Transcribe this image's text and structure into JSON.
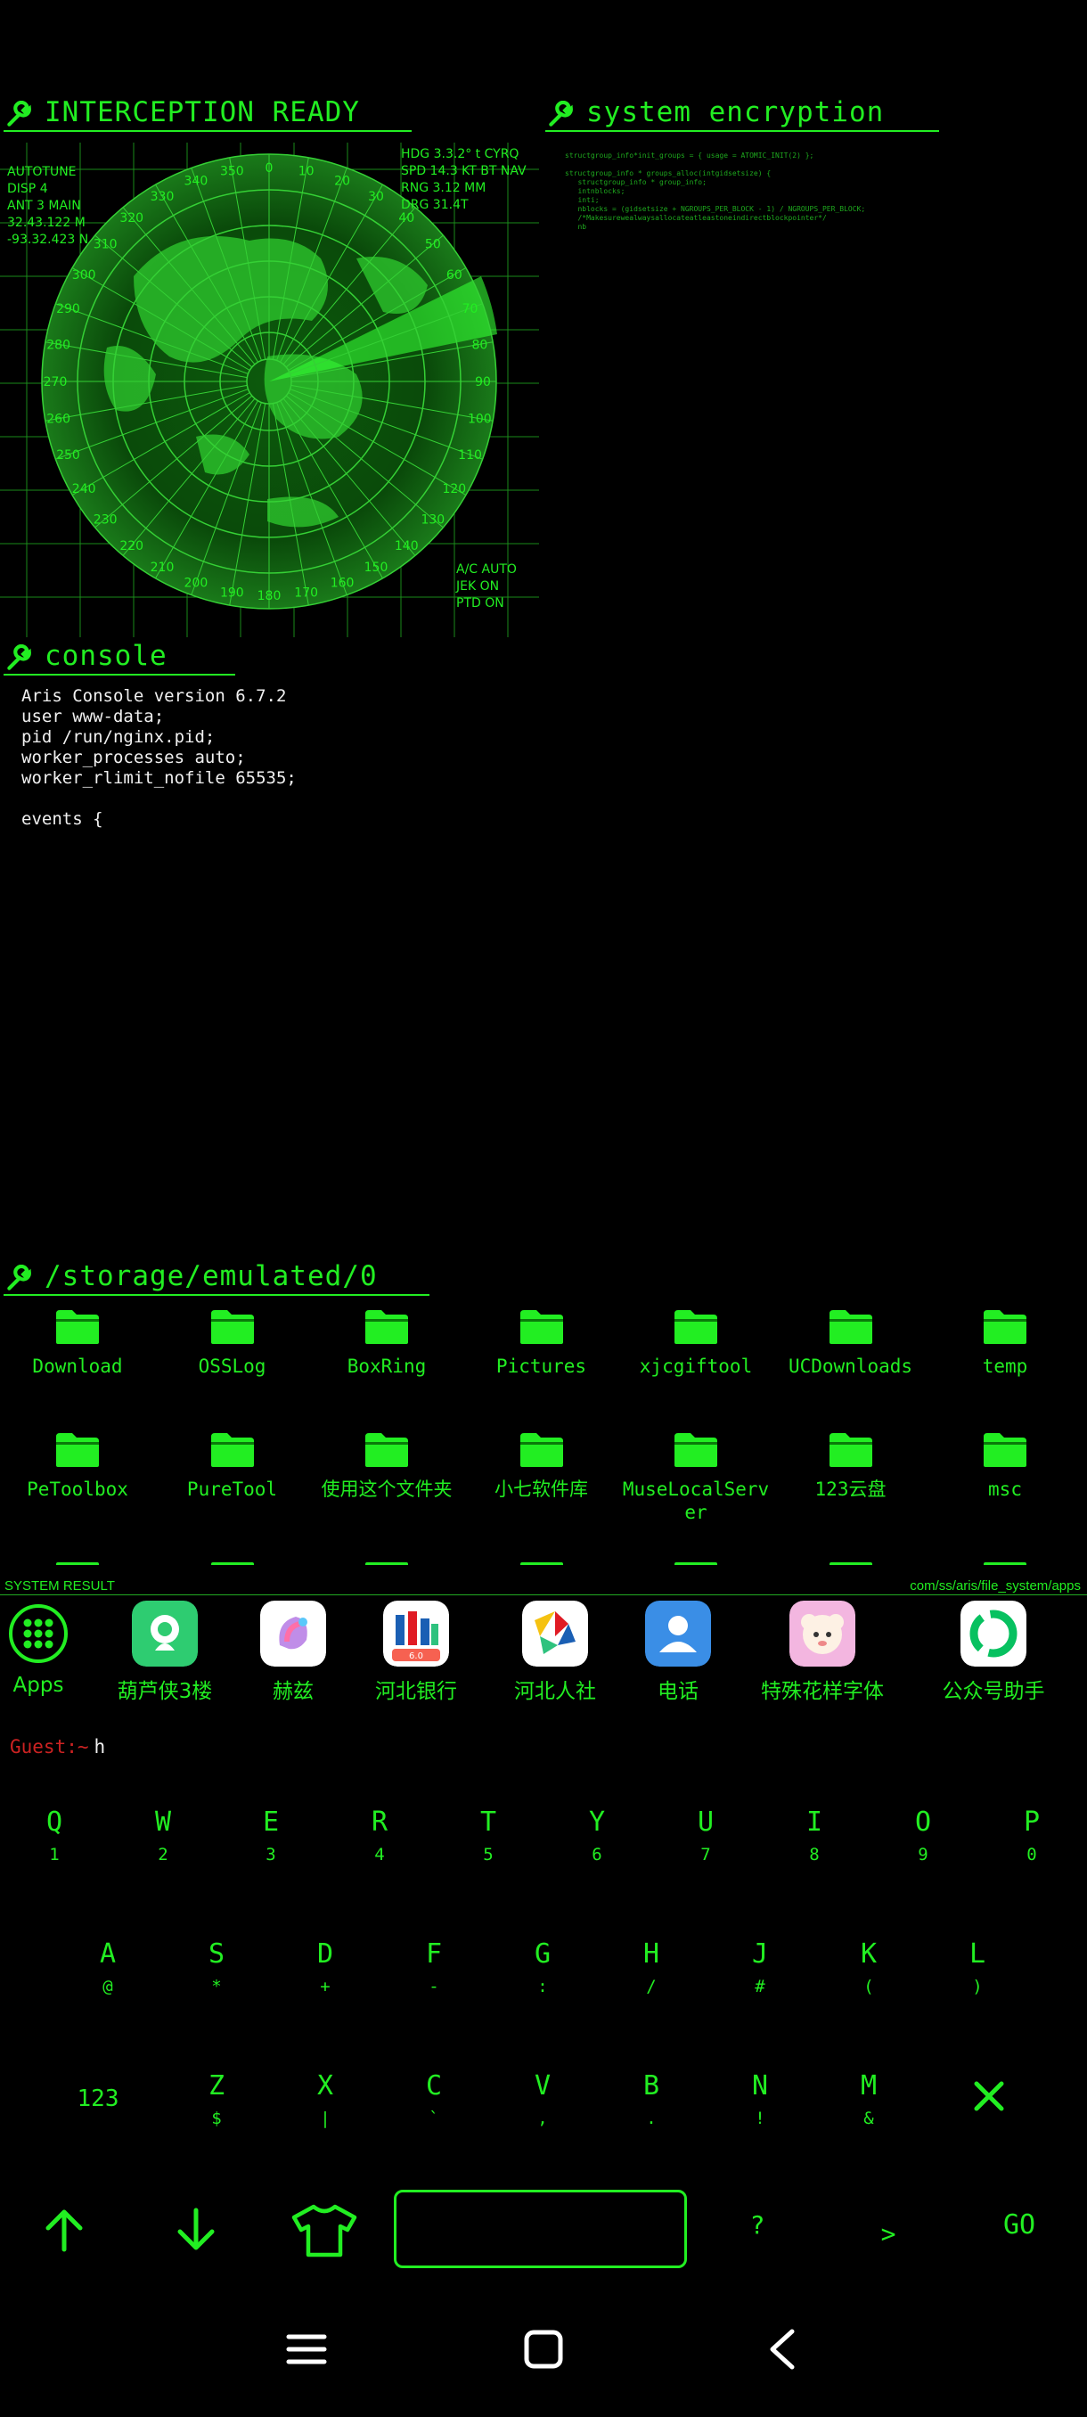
{
  "panels": {
    "radar_title": "INTERCEPTION READY",
    "encryption_title": "system encryption",
    "console_title": "console",
    "storage_title": "/storage/emulated/0"
  },
  "radar": {
    "left_info": [
      "AUTOTUNE",
      "DISP 4",
      "ANT 3 MAIN",
      "32.43.122 M",
      "-93.32.423 N"
    ],
    "right_info": [
      "HDG 3.3.2° t CYRQ",
      "SPD 14.3 KT BT NAV",
      "RNG 3.12 MM",
      "DRG 31.4T"
    ],
    "bottom_right_info": [
      "A/C AUTO",
      "JEK ON",
      "PTD ON"
    ],
    "bearings": [
      "0",
      "10",
      "20",
      "30",
      "40",
      "50",
      "60",
      "70",
      "80",
      "90",
      "100",
      "110",
      "120",
      "130",
      "140",
      "150",
      "160",
      "170",
      "180",
      "190",
      "200",
      "210",
      "220",
      "230",
      "240",
      "250",
      "260",
      "270",
      "280",
      "290",
      "300",
      "310",
      "320",
      "330",
      "340",
      "350"
    ]
  },
  "encryption_code": "structgroup_info*init_groups = { usage = ATOMIC_INIT(2) };\n\nstructgroup_info * groups_alloc(intgidsetsize) {\n   structgroup_info * group_info;\n   intnblocks;\n   inti;\n   nblocks = (gidsetsize + NGROUPS_PER_BLOCK - 1) / NGROUPS_PER_BLOCK;\n   /*Makesurewealwaysallocateatleastoneindirectblockpointer*/\n   nb",
  "console_lines": "Aris Console version 6.7.2\nuser www-data;\npid /run/nginx.pid;\nworker_processes auto;\nworker_rlimit_nofile 65535;\n\nevents {",
  "files": [
    {
      "name": "Download"
    },
    {
      "name": "OSSLog"
    },
    {
      "name": "BoxRing"
    },
    {
      "name": "Pictures"
    },
    {
      "name": "xjcgiftool"
    },
    {
      "name": "UCDownloads"
    },
    {
      "name": "temp"
    },
    {
      "name": "PeToolbox"
    },
    {
      "name": "PureTool"
    },
    {
      "name": "使用这个文件夹"
    },
    {
      "name": "小七软件库"
    },
    {
      "name": "MuseLocalServer"
    },
    {
      "name": "123云盘"
    },
    {
      "name": "msc"
    }
  ],
  "status": {
    "left": "SYSTEM RESULT",
    "right": "com/ss/aris/file_system/apps"
  },
  "dock": [
    {
      "label": "Apps",
      "icon": "apps-grid-icon"
    },
    {
      "label": "葫芦侠3楼",
      "icon": "huluxia-icon"
    },
    {
      "label": "赫兹",
      "icon": "hertz-icon"
    },
    {
      "label": "河北银行",
      "icon": "hebei-bank-icon"
    },
    {
      "label": "河北人社",
      "icon": "hebei-renshe-icon"
    },
    {
      "label": "电话",
      "icon": "phone-contact-icon"
    },
    {
      "label": "特殊花样字体",
      "icon": "sheep-font-icon"
    },
    {
      "label": "公众号助手",
      "icon": "wechat-assistant-icon"
    }
  ],
  "prompt": {
    "user": "Guest:~",
    "input": "h"
  },
  "keyboard": {
    "row1": [
      {
        "k": "Q",
        "s": "1"
      },
      {
        "k": "W",
        "s": "2"
      },
      {
        "k": "E",
        "s": "3"
      },
      {
        "k": "R",
        "s": "4"
      },
      {
        "k": "T",
        "s": "5"
      },
      {
        "k": "Y",
        "s": "6"
      },
      {
        "k": "U",
        "s": "7"
      },
      {
        "k": "I",
        "s": "8"
      },
      {
        "k": "O",
        "s": "9"
      },
      {
        "k": "P",
        "s": "0"
      }
    ],
    "row2": [
      {
        "k": "A",
        "s": "@"
      },
      {
        "k": "S",
        "s": "*"
      },
      {
        "k": "D",
        "s": "+"
      },
      {
        "k": "F",
        "s": "-"
      },
      {
        "k": "G",
        "s": ":"
      },
      {
        "k": "H",
        "s": "/"
      },
      {
        "k": "J",
        "s": "#"
      },
      {
        "k": "K",
        "s": "("
      },
      {
        "k": "L",
        "s": ")"
      }
    ],
    "row3": [
      {
        "k": "Z",
        "s": "$"
      },
      {
        "k": "X",
        "s": "|"
      },
      {
        "k": "C",
        "s": "`"
      },
      {
        "k": "V",
        "s": ","
      },
      {
        "k": "B",
        "s": "."
      },
      {
        "k": "N",
        "s": "!"
      },
      {
        "k": "M",
        "s": "&"
      }
    ],
    "num_key": "123",
    "question_key": "?",
    "gt_key": ">",
    "go_key": "GO"
  },
  "colors": {
    "accent": "#22ee22",
    "background": "#000000",
    "prompt_user": "#cc2222"
  }
}
